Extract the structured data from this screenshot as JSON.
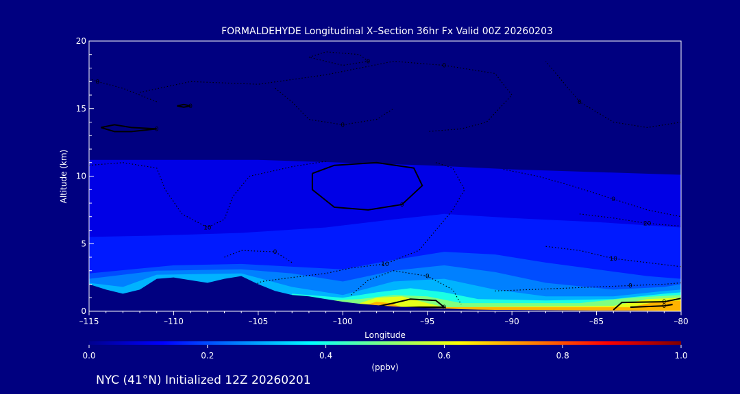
{
  "chart_data": {
    "type": "heatmap",
    "title": "FORMALDEHYDE Longitudinal X–Section 36hr  Fx Valid 00Z 20260203",
    "xlabel": "Longitude",
    "ylabel": "Altitude (km)",
    "xlim": [
      -115,
      -80
    ],
    "ylim": [
      0,
      20
    ],
    "x_ticks": [
      -115,
      -110,
      -105,
      -100,
      -95,
      -90,
      -85,
      -80
    ],
    "x_tick_labels": [
      "–115",
      "–110",
      "–105",
      "–100",
      "–95",
      "–90",
      "–85",
      "–80"
    ],
    "y_ticks": [
      0,
      5,
      10,
      15,
      20
    ],
    "y_tick_labels": [
      "0",
      "5",
      "10",
      "15",
      "20"
    ],
    "colorbar": {
      "label": "(ppbv)",
      "min": 0.0,
      "max": 1.0,
      "ticks": [
        0.0,
        0.2,
        0.4,
        0.6,
        0.8,
        1.0
      ],
      "tick_labels": [
        "0.0",
        "0.2",
        "0.4",
        "0.6",
        "0.8",
        "1.0"
      ]
    },
    "terrain_km": [
      [
        -115,
        2.0
      ],
      [
        -114,
        1.6
      ],
      [
        -113,
        1.3
      ],
      [
        -112,
        1.6
      ],
      [
        -111,
        2.4
      ],
      [
        -110,
        2.5
      ],
      [
        -109,
        2.3
      ],
      [
        -108,
        2.1
      ],
      [
        -107,
        2.4
      ],
      [
        -106,
        2.6
      ],
      [
        -105,
        2.0
      ],
      [
        -104,
        1.5
      ],
      [
        -103,
        1.2
      ],
      [
        -102,
        1.1
      ],
      [
        -101,
        0.9
      ],
      [
        -100,
        0.7
      ],
      [
        -99,
        0.55
      ],
      [
        -98,
        0.45
      ],
      [
        -97,
        0.35
      ],
      [
        -96,
        0.3
      ],
      [
        -95,
        0.25
      ],
      [
        -94,
        0.2
      ],
      [
        -93,
        0.15
      ],
      [
        -92,
        0.12
      ],
      [
        -91,
        0.1
      ],
      [
        -90,
        0.1
      ],
      [
        -88,
        0.08
      ],
      [
        -85,
        0.05
      ],
      [
        -83,
        0.05
      ],
      [
        -80,
        0.02
      ]
    ],
    "concentration_layers": [
      {
        "label": "0.10",
        "value": 0.1,
        "top": [
          [
            -115,
            11.2
          ],
          [
            -105,
            11.2
          ],
          [
            -100,
            11.0
          ],
          [
            -95,
            10.8
          ],
          [
            -90,
            10.5
          ],
          [
            -85,
            10.3
          ],
          [
            -80,
            10.1
          ]
        ]
      },
      {
        "label": "0.15",
        "value": 0.15,
        "top": [
          [
            -115,
            5.5
          ],
          [
            -111,
            5.6
          ],
          [
            -106,
            5.8
          ],
          [
            -101,
            6.2
          ],
          [
            -97,
            6.8
          ],
          [
            -94,
            7.2
          ],
          [
            -90,
            6.9
          ],
          [
            -85,
            6.6
          ],
          [
            -80,
            6.2
          ]
        ]
      },
      {
        "label": "0.20",
        "value": 0.2,
        "top": [
          [
            -115,
            2.8
          ],
          [
            -110,
            3.4
          ],
          [
            -106,
            3.5
          ],
          [
            -103,
            3.3
          ],
          [
            -100,
            3.1
          ],
          [
            -97,
            3.8
          ],
          [
            -94,
            4.4
          ],
          [
            -91,
            4.2
          ],
          [
            -88,
            3.6
          ],
          [
            -85,
            3.1
          ],
          [
            -82,
            2.6
          ],
          [
            -80,
            2.4
          ]
        ]
      },
      {
        "label": "0.25",
        "value": 0.25,
        "top": [
          [
            -115,
            2.4
          ],
          [
            -111,
            3.0
          ],
          [
            -106,
            3.1
          ],
          [
            -103,
            2.8
          ],
          [
            -100,
            2.2
          ],
          [
            -97,
            3.0
          ],
          [
            -94,
            3.4
          ],
          [
            -91,
            2.9
          ],
          [
            -88,
            2.1
          ],
          [
            -84,
            1.6
          ],
          [
            -81,
            1.8
          ],
          [
            -80,
            2.0
          ]
        ]
      },
      {
        "label": "0.30",
        "value": 0.3,
        "top": [
          [
            -115,
            2.1
          ],
          [
            -113,
            1.8
          ],
          [
            -111,
            2.7
          ],
          [
            -106,
            2.8
          ],
          [
            -103,
            1.8
          ],
          [
            -100,
            1.2
          ],
          [
            -97,
            2.2
          ],
          [
            -94,
            2.4
          ],
          [
            -91,
            1.6
          ],
          [
            -88,
            1.1
          ],
          [
            -84,
            1.1
          ],
          [
            -81,
            1.5
          ],
          [
            -80,
            1.6
          ]
        ]
      },
      {
        "label": "0.40",
        "value": 0.4,
        "top": [
          [
            -103,
            1.3
          ],
          [
            -100,
            1.0
          ],
          [
            -98,
            1.4
          ],
          [
            -96,
            1.7
          ],
          [
            -94,
            1.4
          ],
          [
            -92,
            0.9
          ],
          [
            -88,
            0.8
          ],
          [
            -84,
            0.9
          ],
          [
            -81,
            1.3
          ],
          [
            -80,
            1.4
          ]
        ]
      },
      {
        "label": "0.50",
        "value": 0.5,
        "top": [
          [
            -101,
            0.8
          ],
          [
            -99,
            0.9
          ],
          [
            -97,
            1.2
          ],
          [
            -95,
            1.1
          ],
          [
            -93,
            0.6
          ],
          [
            -86,
            0.6
          ],
          [
            -83,
            1.0
          ],
          [
            -80,
            1.2
          ]
        ]
      },
      {
        "label": "0.60",
        "value": 0.6,
        "top": [
          [
            -99,
            0.6
          ],
          [
            -98,
            1.0
          ],
          [
            -96.5,
            1.1
          ],
          [
            -95,
            0.6
          ],
          [
            -94,
            0.3
          ],
          [
            -84,
            0.4
          ],
          [
            -82,
            0.9
          ],
          [
            -80,
            1.0
          ]
        ]
      },
      {
        "label": "0.70",
        "value": 0.7,
        "top": [
          [
            -98.8,
            0.4
          ],
          [
            -98,
            0.7
          ],
          [
            -97.2,
            0.6
          ],
          [
            -96.5,
            0.3
          ],
          [
            -83,
            0.3
          ],
          [
            -81.5,
            0.7
          ],
          [
            -80,
            0.8
          ]
        ]
      }
    ],
    "contours": [
      {
        "label": "0",
        "style": "solid",
        "points": [
          [
            -101.8,
            10.2
          ],
          [
            -100.5,
            10.8
          ],
          [
            -98,
            11.0
          ],
          [
            -95.8,
            10.6
          ],
          [
            -95.3,
            9.3
          ],
          [
            -96.5,
            7.9
          ],
          [
            -98.5,
            7.5
          ],
          [
            -100.5,
            7.7
          ],
          [
            -101.8,
            9.0
          ],
          [
            -101.8,
            10.2
          ]
        ]
      },
      {
        "label": "0",
        "style": "solid",
        "points": [
          [
            -114.3,
            13.6
          ],
          [
            -113.5,
            13.8
          ],
          [
            -112.5,
            13.6
          ],
          [
            -111,
            13.5
          ],
          [
            -112.5,
            13.3
          ],
          [
            -113.5,
            13.3
          ],
          [
            -114.3,
            13.6
          ]
        ]
      },
      {
        "label": "0",
        "style": "solid",
        "points": [
          [
            -109.8,
            15.2
          ],
          [
            -109.4,
            15.3
          ],
          [
            -109,
            15.2
          ],
          [
            -109.4,
            15.1
          ],
          [
            -109.8,
            15.2
          ]
        ]
      },
      {
        "label": "0",
        "style": "solid",
        "points": [
          [
            -98,
            0.35
          ],
          [
            -97,
            0.6
          ],
          [
            -96,
            0.9
          ],
          [
            -94.5,
            0.8
          ],
          [
            -94,
            0.3
          ],
          [
            -95.5,
            0.3
          ],
          [
            -97,
            0.25
          ],
          [
            -98,
            0.35
          ]
        ]
      },
      {
        "label": "0",
        "style": "solid",
        "points": [
          [
            -84,
            0.1
          ],
          [
            -83.5,
            0.65
          ],
          [
            -81,
            0.7
          ],
          [
            -80,
            0.95
          ]
        ]
      },
      {
        "label": "0",
        "style": "solid",
        "points": [
          [
            -83,
            0.3
          ],
          [
            -81,
            0.4
          ],
          [
            -80.5,
            0.5
          ]
        ]
      },
      {
        "label": "10",
        "style": "dotted",
        "points": [
          [
            -115,
            10.8
          ],
          [
            -113,
            11.0
          ],
          [
            -111,
            10.6
          ],
          [
            -110.5,
            9.0
          ],
          [
            -109.5,
            7.2
          ],
          [
            -108,
            6.2
          ],
          [
            -107,
            6.8
          ],
          [
            -106.5,
            8.5
          ],
          [
            -105.5,
            10.0
          ],
          [
            -103,
            10.7
          ],
          [
            -101,
            11.1
          ]
        ]
      },
      {
        "label": "10",
        "style": "dotted",
        "points": [
          [
            -94.5,
            11.0
          ],
          [
            -93.5,
            10.6
          ],
          [
            -92.8,
            9.0
          ],
          [
            -93.5,
            7.5
          ],
          [
            -94.5,
            6.0
          ],
          [
            -95.5,
            4.5
          ],
          [
            -97.5,
            3.5
          ],
          [
            -99.5,
            3.2
          ],
          [
            -101,
            2.8
          ],
          [
            -103,
            2.5
          ],
          [
            -104.8,
            2.2
          ],
          [
            -106,
            1.5
          ]
        ]
      },
      {
        "label": "10",
        "style": "dotted",
        "points": [
          [
            -88,
            4.8
          ],
          [
            -86,
            4.5
          ],
          [
            -84,
            3.9
          ],
          [
            -82,
            3.6
          ],
          [
            -80,
            3.3
          ]
        ]
      },
      {
        "label": "20",
        "style": "dotted",
        "points": [
          [
            -86,
            7.2
          ],
          [
            -84,
            6.9
          ],
          [
            -82,
            6.5
          ],
          [
            -80,
            6.3
          ]
        ]
      },
      {
        "label": "0",
        "style": "dotted",
        "points": [
          [
            -91,
            1.5
          ],
          [
            -87,
            1.7
          ],
          [
            -83,
            1.9
          ],
          [
            -81,
            2.0
          ],
          [
            -80,
            2.1
          ]
        ]
      },
      {
        "label": "0",
        "style": "dotted",
        "points": [
          [
            -99.5,
            1.2
          ],
          [
            -98.5,
            2.3
          ],
          [
            -97,
            3.0
          ],
          [
            -95,
            2.6
          ],
          [
            -93.5,
            1.6
          ],
          [
            -93,
            0.5
          ]
        ]
      },
      {
        "label": "0",
        "style": "dotted",
        "points": [
          [
            -112,
            16.2
          ],
          [
            -109,
            17.0
          ],
          [
            -105,
            16.8
          ],
          [
            -101,
            17.5
          ],
          [
            -97,
            18.5
          ],
          [
            -94,
            18.2
          ],
          [
            -91,
            17.6
          ],
          [
            -90,
            16.0
          ],
          [
            -91.5,
            14.0
          ],
          [
            -93,
            13.5
          ],
          [
            -95,
            13.3
          ]
        ]
      },
      {
        "label": "0",
        "style": "dotted",
        "points": [
          [
            -102,
            18.8
          ],
          [
            -101,
            19.2
          ],
          [
            -99,
            19.0
          ],
          [
            -98.5,
            18.5
          ],
          [
            -100,
            18.2
          ],
          [
            -102,
            18.8
          ]
        ]
      },
      {
        "label": "0",
        "style": "dotted",
        "points": [
          [
            -104,
            16.5
          ],
          [
            -103,
            15.5
          ],
          [
            -102,
            14.2
          ],
          [
            -100,
            13.8
          ],
          [
            -98,
            14.2
          ],
          [
            -97,
            15.0
          ]
        ]
      },
      {
        "label": "0",
        "style": "dotted",
        "points": [
          [
            -111,
            15.5
          ],
          [
            -113,
            16.5
          ],
          [
            -114.5,
            17.0
          ],
          [
            -115,
            17.2
          ]
        ]
      },
      {
        "label": "0",
        "style": "dotted",
        "points": [
          [
            -80,
            14.0
          ],
          [
            -82,
            13.6
          ],
          [
            -84,
            14.0
          ],
          [
            -86,
            15.5
          ],
          [
            -87,
            17.0
          ],
          [
            -88,
            18.5
          ]
        ]
      },
      {
        "label": "0",
        "style": "dotted",
        "points": [
          [
            -90.5,
            10.5
          ],
          [
            -88.5,
            10.0
          ],
          [
            -86.5,
            9.3
          ],
          [
            -84,
            8.3
          ],
          [
            -82,
            7.5
          ],
          [
            -80,
            7.0
          ]
        ]
      },
      {
        "label": "0",
        "style": "dotted",
        "points": [
          [
            -107,
            4.0
          ],
          [
            -106,
            4.5
          ],
          [
            -104,
            4.4
          ],
          [
            -103,
            3.6
          ]
        ]
      }
    ],
    "footer": "NYC (41°N) Initialized 12Z 20260201"
  }
}
